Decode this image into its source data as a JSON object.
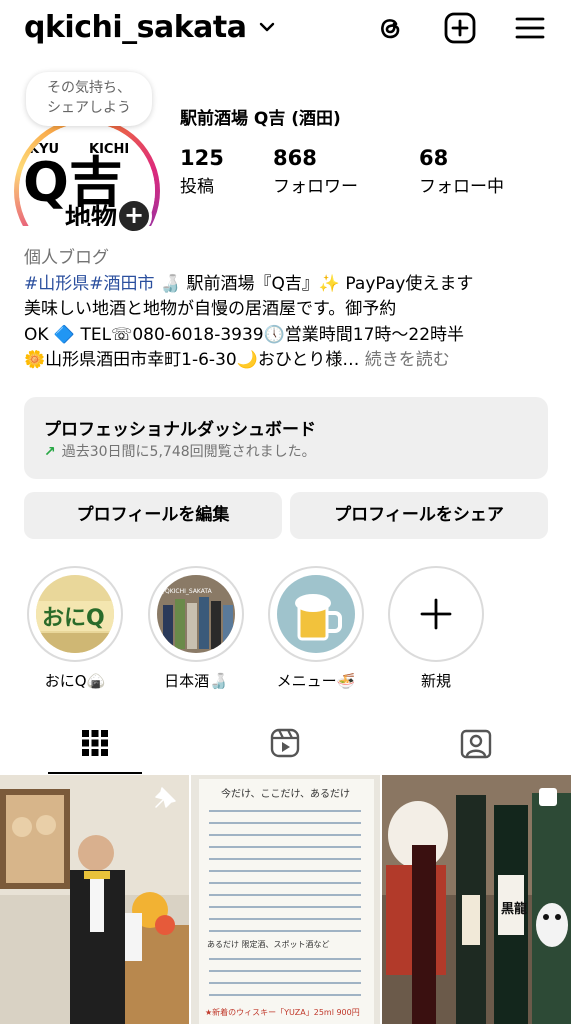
{
  "header": {
    "username": "qkichi_sakata",
    "icons": [
      "chevron-down-icon",
      "threads-icon",
      "new-post-icon",
      "menu-icon"
    ]
  },
  "note": {
    "line1": "その気持ち、",
    "line2": "シェアしよう"
  },
  "profile": {
    "display_name": "駅前酒場 Q吉 (酒田)",
    "stats": {
      "posts": {
        "value": "125",
        "label": "投稿"
      },
      "followers": {
        "value": "868",
        "label": "フォロワー"
      },
      "following": {
        "value": "68",
        "label": "フォロー中"
      }
    },
    "avatar_text": {
      "top": "KYU",
      "top2": "KICHI",
      "main": "Q吉",
      "sub": "地物"
    }
  },
  "bio": {
    "category": "個人ブログ",
    "tags": "#山形県#酒田市",
    "line1_rest": " 🍶 駅前酒場『Q吉』✨ PayPay使えます",
    "line2": "美味しい地酒と地物が自慢の居酒屋です。御予約",
    "line3": "OK 🔷 TEL☏080-6018-3939🕔営業時間17時〜22時半",
    "line4": "🌼山形県酒田市幸町1-6-30🌙おひとり様…",
    "more": " 続きを読む"
  },
  "dashboard": {
    "title": "プロフェッショナルダッシュボード",
    "arrow": "↗",
    "subtitle": "過去30日間に5,748回閲覧されました。"
  },
  "buttons": {
    "edit": "プロフィールを編集",
    "share": "プロフィールをシェア"
  },
  "highlights": [
    {
      "label": "おにQ🍙",
      "image_text": "おにQ"
    },
    {
      "label": "日本酒🍶",
      "image_text": "@QKICHI_SAKATA"
    },
    {
      "label": "メニュー🍜",
      "image_text": ""
    },
    {
      "label": "新規",
      "image_text": ""
    }
  ],
  "tabs": [
    "grid-icon",
    "reels-icon",
    "tagged-icon"
  ],
  "grid": {
    "posts": [
      "pinned-post-photo",
      "menu-board-photo",
      "sake-bottles-photo"
    ],
    "menu_heading": "今だけ、ここだけ、あるだけ",
    "menu_subheading": "あるだけ 限定酒、スポット酒など",
    "menu_footer": "★新着のウィスキー「YUZA」25ml 900円",
    "sake_label": "黒龍"
  }
}
